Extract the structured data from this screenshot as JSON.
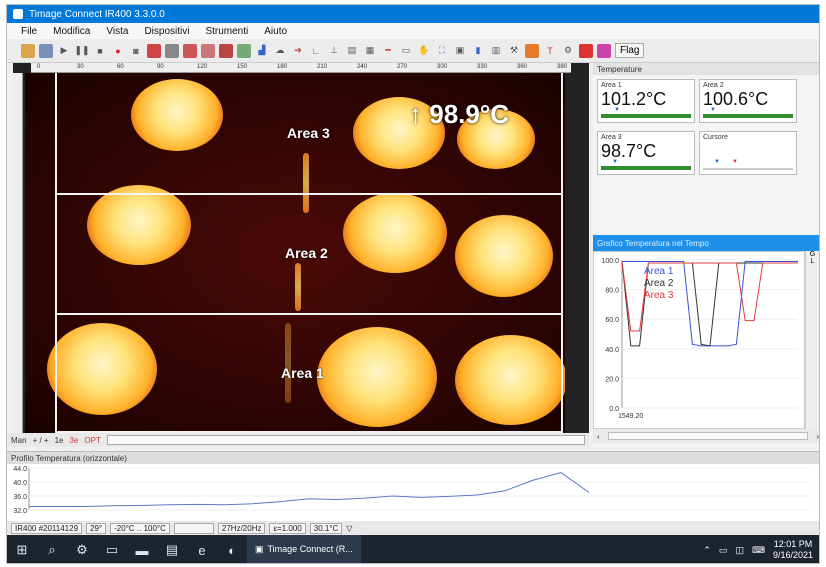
{
  "window": {
    "title": "Timage Connect IR400 3.3.0.0"
  },
  "menu": [
    "File",
    "Modifica",
    "Vista",
    "Dispositivi",
    "Strumenti",
    "Aiuto"
  ],
  "toolbar": {
    "flag_label": "Flag"
  },
  "ruler_top": [
    "0",
    "30",
    "60",
    "90",
    "120",
    "150",
    "180",
    "210",
    "240",
    "270",
    "300",
    "330",
    "360",
    "380"
  ],
  "image": {
    "areas": [
      {
        "label": "Area 3"
      },
      {
        "label": "Area 2"
      },
      {
        "label": "Area 1"
      }
    ],
    "max_temp": "98.9°C",
    "max_arrow": "↑"
  },
  "image_bottom": {
    "man": "Man",
    "nav": "+ / +",
    "a": "1e",
    "b": "3e",
    "opt": "OPT"
  },
  "temperature_panel": {
    "title": "Temperature",
    "tiles": [
      {
        "name": "Area 1",
        "value": "101.2°C"
      },
      {
        "name": "Area 2",
        "value": "100.6°C"
      },
      {
        "name": "Area 3",
        "value": "98.7°C"
      },
      {
        "name": "Cursore",
        "value": ""
      }
    ]
  },
  "graph": {
    "title": "Grafico Temperatura nel Tempo",
    "x_start_label": "1549.20",
    "legend": [
      "Area 1",
      "Area 2",
      "Area 3"
    ],
    "colors": {
      "area1": "#3a53d6",
      "area2": "#333333",
      "area3": "#e23b3b"
    },
    "scroll": [
      "G",
      "L"
    ]
  },
  "profile": {
    "title": "Profilo Temperatura (orizzontale)"
  },
  "chart_data": [
    {
      "type": "line",
      "title": "Grafico Temperatura nel Tempo",
      "xlabel": "",
      "ylabel": "",
      "ylim": [
        0,
        100
      ],
      "yticks": [
        "100.0",
        "80.0",
        "60.0",
        "40.0",
        "20.0",
        "0.0"
      ],
      "x": [
        0,
        3,
        6,
        9,
        12,
        15,
        18,
        21,
        24,
        27,
        30,
        33,
        36,
        39,
        42,
        45,
        48,
        51,
        54,
        57,
        60
      ],
      "series": [
        {
          "name": "Area 1",
          "values": [
            99,
            99,
            99,
            99,
            99,
            99,
            99,
            99,
            43,
            42,
            42,
            42,
            42,
            43,
            99,
            99,
            99,
            99,
            99,
            99,
            99
          ]
        },
        {
          "name": "Area 2",
          "values": [
            99,
            42,
            42,
            98,
            98,
            98,
            98,
            98,
            98,
            43,
            42,
            98,
            98,
            98,
            98,
            98,
            98,
            98,
            98,
            98,
            98
          ]
        },
        {
          "name": "Area 3",
          "values": [
            99,
            52,
            52,
            98,
            98,
            98,
            98,
            98,
            98,
            98,
            98,
            98,
            98,
            98,
            59,
            59,
            98,
            98,
            98,
            98,
            98
          ]
        }
      ]
    },
    {
      "type": "line",
      "title": "Profilo Temperatura (orizzontale)",
      "ylim": [
        32,
        44
      ],
      "yticks": [
        "44.0",
        "40.0",
        "36.0",
        "32.0"
      ],
      "x": [
        0,
        5,
        10,
        15,
        20,
        25,
        30,
        35,
        40,
        45,
        50,
        55,
        60,
        65,
        70,
        75,
        80,
        85,
        90,
        95,
        100
      ],
      "series": [
        {
          "values": [
            33,
            33,
            33,
            33.2,
            33.3,
            33.5,
            33.6,
            33.5,
            33.8,
            34.4,
            35.2,
            35,
            35.4,
            36,
            35.6,
            35.9,
            36.3,
            37.5,
            40.5,
            42.7,
            37
          ]
        }
      ]
    }
  ],
  "status": {
    "device": "IR400 #20114129",
    "fov": "29°",
    "range": "-20°C .. 100°C",
    "rate": "27Hz/20Hz",
    "emissivity": "ε=1.000",
    "ambient": "30.1°C"
  },
  "taskbar": {
    "app_label": "Timage Connect (R...",
    "time": "12:01 PM",
    "date": "9/16/2021"
  }
}
